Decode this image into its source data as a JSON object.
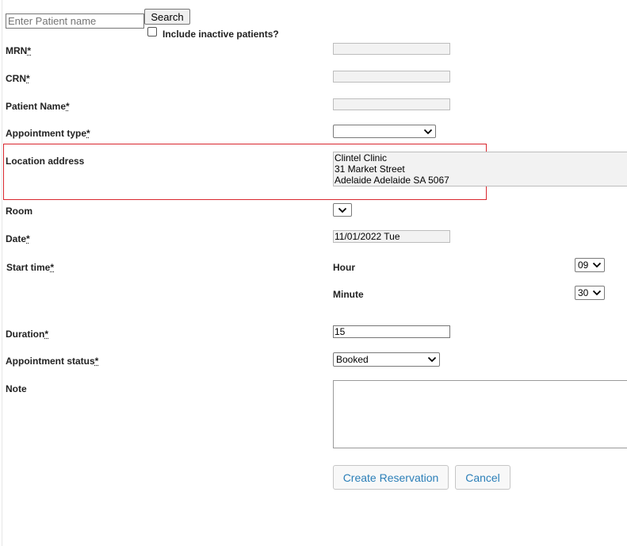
{
  "search": {
    "placeholder": "Enter Patient name",
    "button_label": "Search",
    "include_inactive_label": "Include inactive patients?",
    "include_inactive_checked": false
  },
  "form": {
    "mrn_label": "MRN",
    "crn_label": "CRN",
    "patient_name_label": "Patient Name",
    "appointment_type_label": "Appointment type",
    "appointment_type_value": "",
    "location_label": "Location address",
    "location_lines": [
      "Clintel Clinic",
      "31 Market Street",
      "Adelaide Adelaide SA 5067"
    ],
    "room_label": "Room",
    "room_value": "",
    "date_label": "Date",
    "date_value": "11/01/2022 Tue",
    "start_time_label": "Start time",
    "hour_label": "Hour",
    "hour_value": "09",
    "minute_label": "Minute",
    "minute_value": "30",
    "duration_label": "Duration",
    "duration_value": "15",
    "status_label": "Appointment status",
    "status_value": "Booked",
    "note_label": "Note",
    "required_mark": "*"
  },
  "actions": {
    "create_label": "Create Reservation",
    "cancel_label": "Cancel"
  },
  "colors": {
    "highlight_border": "#d9272e",
    "button_text": "#2b7fb8"
  }
}
